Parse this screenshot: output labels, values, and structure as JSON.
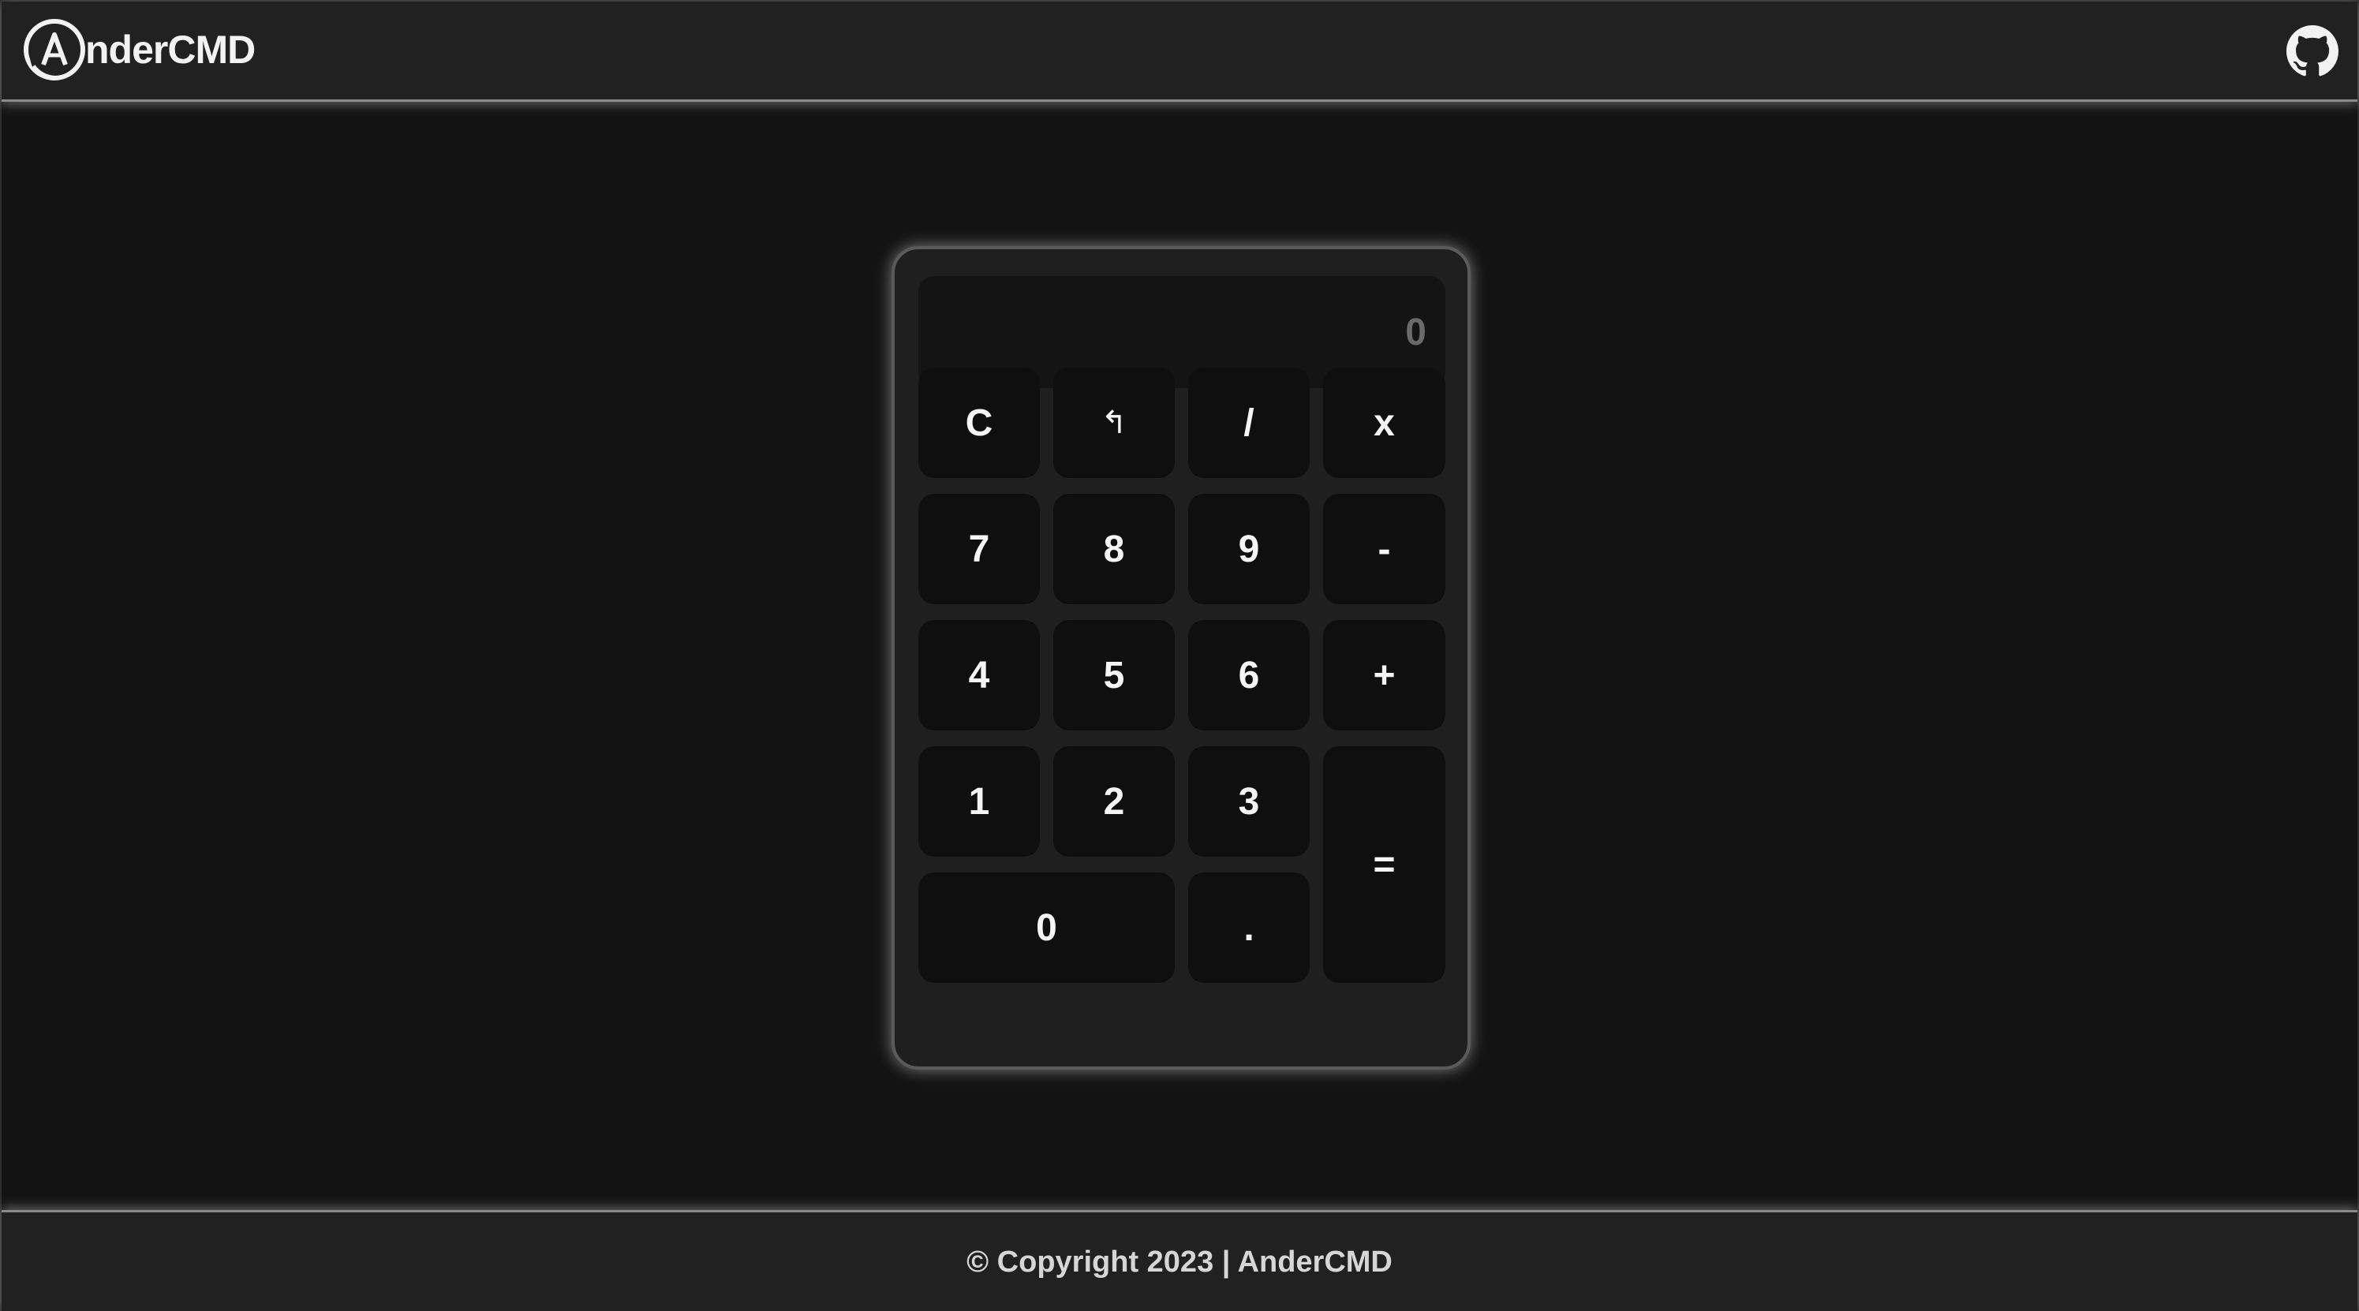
{
  "header": {
    "brand_name": "nderCMD",
    "brand_logo_letter": "A",
    "github_icon": "github-icon"
  },
  "calculator": {
    "display_value": "0",
    "keys": {
      "clear": "C",
      "backspace": "↰",
      "divide": "/",
      "multiply": "x",
      "seven": "7",
      "eight": "8",
      "nine": "9",
      "minus": "-",
      "four": "4",
      "five": "5",
      "six": "6",
      "plus": "+",
      "one": "1",
      "two": "2",
      "three": "3",
      "equals": "=",
      "zero": "0",
      "decimal": "."
    }
  },
  "footer": {
    "copyright": "© Copyright 2023 | AnderCMD"
  },
  "colors": {
    "page_bg": "#131313",
    "bar_bg": "#212121",
    "calc_bg": "#1f1f1f",
    "key_bg": "#0f0f0f",
    "text": "#f5f5f5"
  }
}
